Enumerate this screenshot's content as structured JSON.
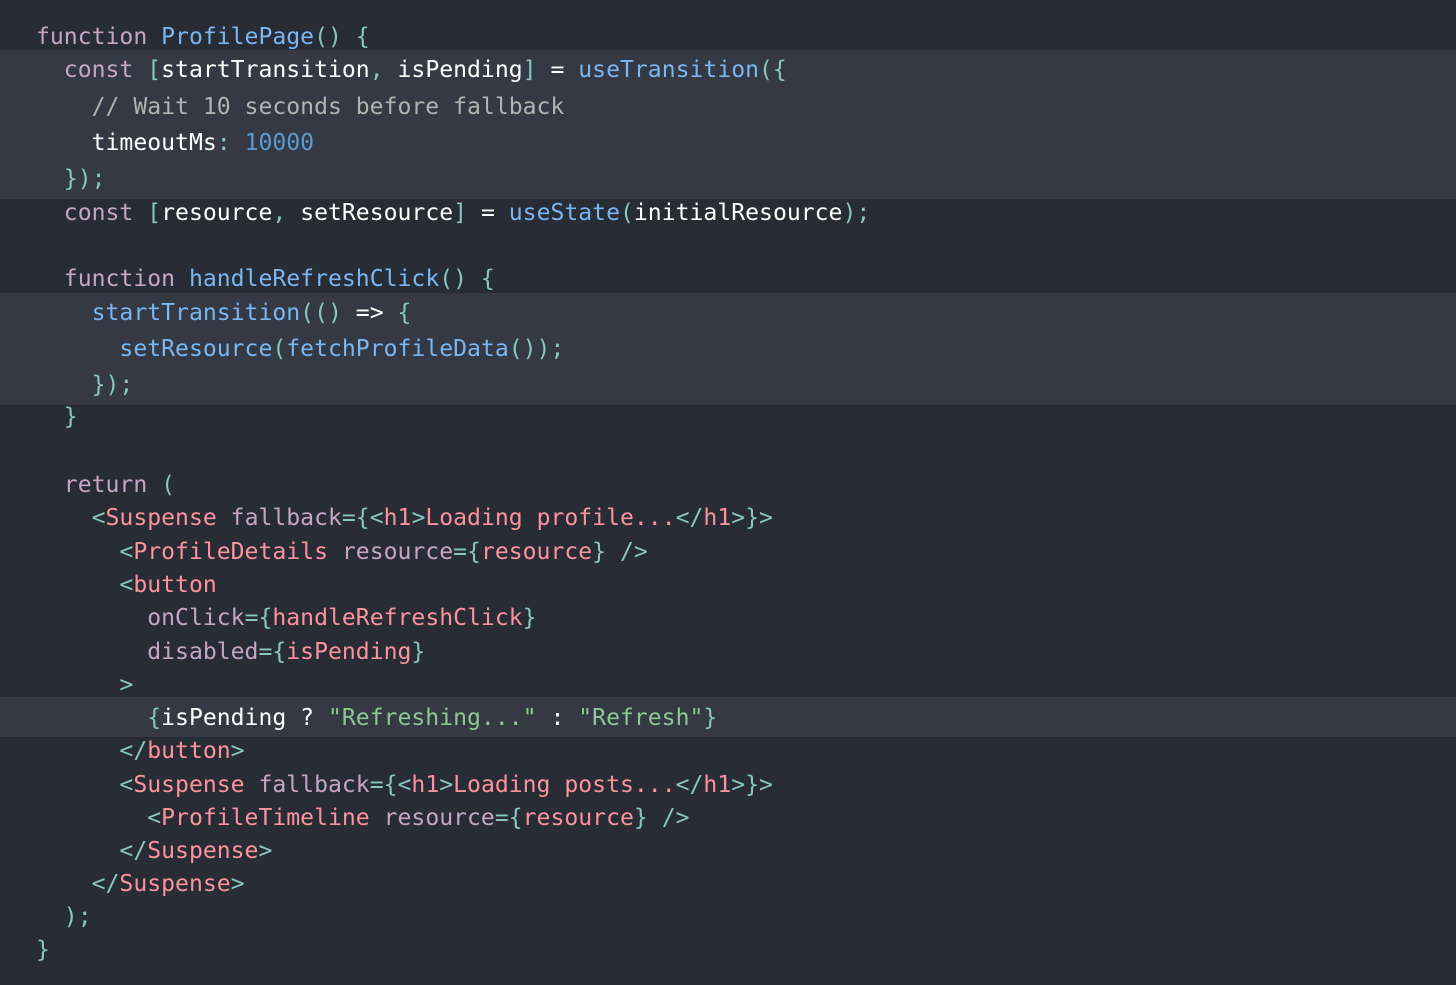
{
  "editor": {
    "background": "#282c34",
    "highlight_color": "#343944",
    "colors": {
      "keyword": "#c5a5c5",
      "function": "#79b6f2",
      "plain": "#ffffff",
      "punctuation": "#88c6be",
      "comment": "#b2b2b2",
      "number": "#5a9bcf",
      "tag": "#fc929e",
      "string": "#8dc891"
    },
    "lines": [
      {
        "tokens": [
          [
            "kw",
            "function"
          ],
          [
            "pl",
            " "
          ],
          [
            "fn",
            "ProfilePage"
          ],
          [
            "pn",
            "() {"
          ]
        ]
      },
      {
        "tokens": [
          [
            "kw",
            "  const "
          ],
          [
            "pn",
            "["
          ],
          [
            "pl",
            "startTransition"
          ],
          [
            "pn",
            ", "
          ],
          [
            "pl",
            "isPending"
          ],
          [
            "pn",
            "] "
          ],
          [
            "pl",
            "= "
          ],
          [
            "fn",
            "useTransition"
          ],
          [
            "pn",
            "({"
          ]
        ]
      },
      {
        "tokens": [
          [
            "cm",
            "    // Wait 10 seconds before fallback"
          ]
        ]
      },
      {
        "tokens": [
          [
            "pl",
            "    timeoutMs"
          ],
          [
            "pn",
            ": "
          ],
          [
            "nm",
            "10000"
          ]
        ]
      },
      {
        "tokens": [
          [
            "pn",
            "  });"
          ]
        ]
      },
      {
        "tokens": [
          [
            "kw",
            "  const "
          ],
          [
            "pn",
            "["
          ],
          [
            "pl",
            "resource"
          ],
          [
            "pn",
            ", "
          ],
          [
            "pl",
            "setResource"
          ],
          [
            "pn",
            "] "
          ],
          [
            "pl",
            "= "
          ],
          [
            "fn",
            "useState"
          ],
          [
            "pn",
            "("
          ],
          [
            "pl",
            "initialResource"
          ],
          [
            "pn",
            ");"
          ]
        ]
      },
      {
        "tokens": []
      },
      {
        "tokens": [
          [
            "kw",
            "  function "
          ],
          [
            "fn",
            "handleRefreshClick"
          ],
          [
            "pn",
            "() {"
          ]
        ]
      },
      {
        "tokens": [
          [
            "fn",
            "    startTransition"
          ],
          [
            "pn",
            "(() "
          ],
          [
            "pl",
            "=>"
          ],
          [
            "pn",
            " {"
          ]
        ]
      },
      {
        "tokens": [
          [
            "fn",
            "      setResource"
          ],
          [
            "pn",
            "("
          ],
          [
            "fn",
            "fetchProfileData"
          ],
          [
            "pn",
            "());"
          ]
        ]
      },
      {
        "tokens": [
          [
            "pn",
            "    });"
          ]
        ]
      },
      {
        "tokens": [
          [
            "pn",
            "  }"
          ]
        ]
      },
      {
        "tokens": []
      },
      {
        "tokens": [
          [
            "kw",
            "  return "
          ],
          [
            "pn",
            "("
          ]
        ]
      },
      {
        "tokens": [
          [
            "pn",
            "    <"
          ],
          [
            "tag",
            "Suspense"
          ],
          [
            "attr",
            " fallback"
          ],
          [
            "pn",
            "={<"
          ],
          [
            "tag",
            "h1"
          ],
          [
            "pn",
            ">"
          ],
          [
            "tag",
            "Loading profile..."
          ],
          [
            "pn",
            "</"
          ],
          [
            "tag",
            "h1"
          ],
          [
            "pn",
            ">}>"
          ]
        ]
      },
      {
        "tokens": [
          [
            "pn",
            "      <"
          ],
          [
            "tag",
            "ProfileDetails"
          ],
          [
            "attr",
            " resource"
          ],
          [
            "pn",
            "={"
          ],
          [
            "tag",
            "resource"
          ],
          [
            "pn",
            "} />"
          ]
        ]
      },
      {
        "tokens": [
          [
            "pn",
            "      <"
          ],
          [
            "tag",
            "button"
          ]
        ]
      },
      {
        "tokens": [
          [
            "attr",
            "        onClick"
          ],
          [
            "pn",
            "={"
          ],
          [
            "tag",
            "handleRefreshClick"
          ],
          [
            "pn",
            "}"
          ]
        ]
      },
      {
        "tokens": [
          [
            "attr",
            "        disabled"
          ],
          [
            "pn",
            "={"
          ],
          [
            "tag",
            "isPending"
          ],
          [
            "pn",
            "}"
          ]
        ]
      },
      {
        "tokens": [
          [
            "pn",
            "      >"
          ]
        ]
      },
      {
        "tokens": [
          [
            "pn",
            "        {"
          ],
          [
            "pl",
            "isPending ? "
          ],
          [
            "str",
            "\"Refreshing...\""
          ],
          [
            "pl",
            " : "
          ],
          [
            "str",
            "\"Refresh\""
          ],
          [
            "pn",
            "}"
          ]
        ]
      },
      {
        "tokens": [
          [
            "pn",
            "      </"
          ],
          [
            "tag",
            "button"
          ],
          [
            "pn",
            ">"
          ]
        ]
      },
      {
        "tokens": [
          [
            "pn",
            "      <"
          ],
          [
            "tag",
            "Suspense"
          ],
          [
            "attr",
            " fallback"
          ],
          [
            "pn",
            "={<"
          ],
          [
            "tag",
            "h1"
          ],
          [
            "pn",
            ">"
          ],
          [
            "tag",
            "Loading posts..."
          ],
          [
            "pn",
            "</"
          ],
          [
            "tag",
            "h1"
          ],
          [
            "pn",
            ">}>"
          ]
        ]
      },
      {
        "tokens": [
          [
            "pn",
            "        <"
          ],
          [
            "tag",
            "ProfileTimeline"
          ],
          [
            "attr",
            " resource"
          ],
          [
            "pn",
            "={"
          ],
          [
            "tag",
            "resource"
          ],
          [
            "pn",
            "} />"
          ]
        ]
      },
      {
        "tokens": [
          [
            "pn",
            "      </"
          ],
          [
            "tag",
            "Suspense"
          ],
          [
            "pn",
            ">"
          ]
        ]
      },
      {
        "tokens": [
          [
            "pn",
            "    </"
          ],
          [
            "tag",
            "Suspense"
          ],
          [
            "pn",
            ">"
          ]
        ]
      },
      {
        "tokens": [
          [
            "pn",
            "  );"
          ]
        ]
      },
      {
        "tokens": [
          [
            "pn",
            "}"
          ]
        ]
      }
    ]
  }
}
